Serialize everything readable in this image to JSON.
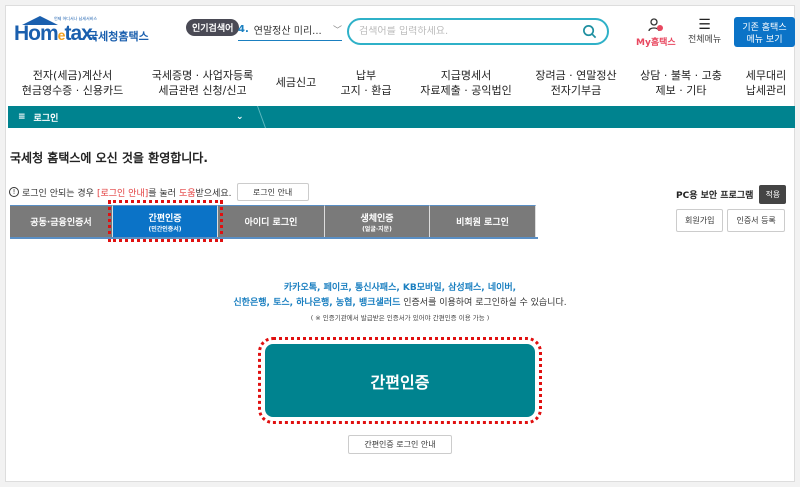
{
  "header": {
    "logo_tagline": "언제 어디서나 납세서비스",
    "logo_en": "Hometax",
    "logo_kr": "국세청홈택스",
    "popular_label": "인기검색어",
    "popular_rank": "4.",
    "popular_term": "연말정산 미리...",
    "search_placeholder": "검색어를 입력하세요.",
    "my_label": "My홈택스",
    "all_menu_label": "전체메뉴",
    "old_menu_line1": "기존 홈택스",
    "old_menu_line2": "메뉴 보기"
  },
  "nav": [
    [
      "전자(세금)계산서",
      "현금영수증 · 신용카드"
    ],
    [
      "국세증명 · 사업자등록",
      "세금관련 신청/신고"
    ],
    [
      "세금신고",
      ""
    ],
    [
      "납부",
      "고지 · 환급"
    ],
    [
      "지급명세서",
      "자료제출 · 공익법인"
    ],
    [
      "장려금 · 연말정산",
      "전자기부금"
    ],
    [
      "상담 · 불복 · 고충",
      "제보 · 기타"
    ],
    [
      "세무대리",
      "납세관리"
    ]
  ],
  "breadcrumb": {
    "label": "로그인"
  },
  "welcome": "국세청 홈택스에 오신 것을 환영합니다.",
  "notice": {
    "text1": "로그인 안되는 경우",
    "link": "[로그인 안내]",
    "text2": "를 눌러",
    "help": "도움",
    "text3": "받으세요.",
    "button": "로그인 안내"
  },
  "security": {
    "label": "PC용 보안 프로그램",
    "button": "적용"
  },
  "tabs": [
    {
      "label": "공동·금융인증서",
      "sub": ""
    },
    {
      "label": "간편인증",
      "sub": "(민간인증서)"
    },
    {
      "label": "아이디 로그인",
      "sub": ""
    },
    {
      "label": "생체인증",
      "sub": "(얼굴·지문)"
    },
    {
      "label": "비회원 로그인",
      "sub": ""
    }
  ],
  "right_buttons": {
    "join": "회원가입",
    "cert_register": "인증서 등록"
  },
  "content": {
    "providers1": "카카오톡, 페이코, 통신사패스, KB모바일, 삼성패스, 네이버,",
    "providers2": "신한은행, 토스, 하나은행, 농협, 뱅크샐러드",
    "desc": " 인증서를 이용하여 로그인하실 수 있습니다.",
    "note": "( ※ 인증기관에서 발급받은 인증서가 있어야 간편인증 이용 가능 )",
    "main_button": "간편인증",
    "guide_button": "간편인증 로그인 안내"
  }
}
